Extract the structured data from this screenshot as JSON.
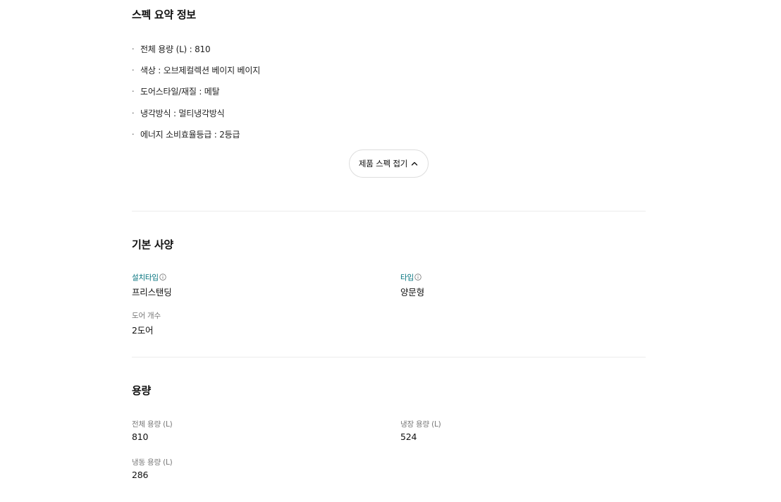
{
  "summary": {
    "title": "스펙 요약 정보",
    "items": [
      "전체 용량 (L) : 810",
      "색상 : 오브제컬렉션 베이지 베이지",
      "도어스타일/재질 : 메탈",
      "냉각방식 : 멀티냉각방식",
      "에너지 소비효율등급 : 2등급"
    ],
    "bullet": "·",
    "toggle_label": "제품 스펙 접기",
    "toggle_icon": "chevron-up-icon"
  },
  "basic": {
    "title": "기본 사양",
    "install_type": {
      "label": "설치타입",
      "value": "프리스탠딩",
      "icon": "info-icon"
    },
    "type": {
      "label": "타입",
      "value": "양문형",
      "icon": "info-icon"
    },
    "door_count": {
      "label": "도어 개수",
      "value": "2도어"
    }
  },
  "capacity": {
    "title": "용량",
    "total": {
      "label": "전체 용량 (L)",
      "value": "810"
    },
    "fridge": {
      "label": "냉장 용량 (L)",
      "value": "524"
    },
    "freezer": {
      "label": "냉동 용량 (L)",
      "value": "286"
    }
  },
  "colors": {
    "link": "#00717c",
    "divider": "#ececec",
    "label": "#777777"
  }
}
